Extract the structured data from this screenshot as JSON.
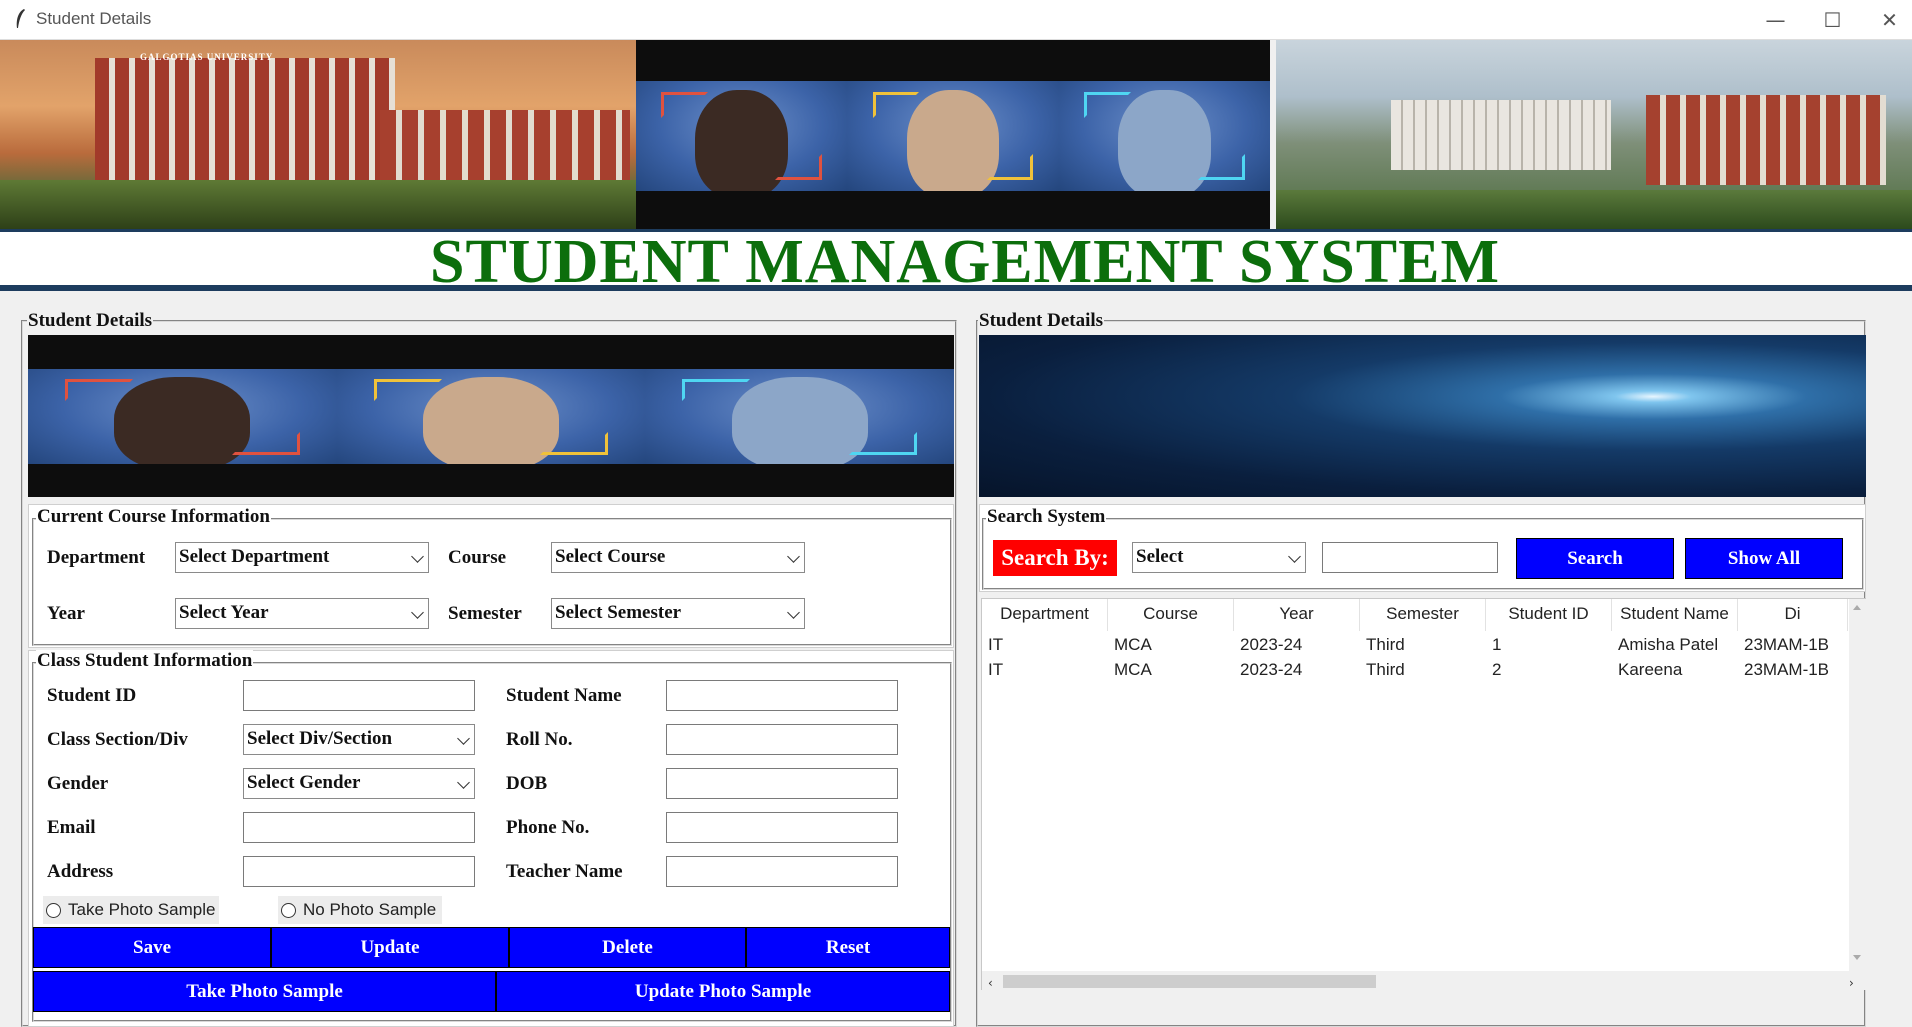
{
  "window": {
    "title": "Student Details",
    "minimize_glyph": "—",
    "maximize_glyph": "☐",
    "close_glyph": "✕"
  },
  "header": {
    "title": "STUDENT MANAGEMENT SYSTEM",
    "university_sign": "GALGOTIAS UNIVERSITY"
  },
  "left_panel": {
    "legend": "Student Details",
    "course_info": {
      "legend": "Current Course Information",
      "department_label": "Department",
      "department_value": "Select Department",
      "course_label": "Course",
      "course_value": "Select Course",
      "year_label": "Year",
      "year_value": "Select Year",
      "semester_label": "Semester",
      "semester_value": "Select Semester"
    },
    "class_info": {
      "legend": "Class Student Information",
      "student_id_label": "Student ID",
      "student_name_label": "Student Name",
      "section_label": "Class Section/Div",
      "section_value": "Select Div/Section",
      "roll_label": "Roll No.",
      "gender_label": "Gender",
      "gender_value": "Select Gender",
      "dob_label": "DOB",
      "email_label": "Email",
      "phone_label": "Phone No.",
      "address_label": "Address",
      "teacher_label": "Teacher Name",
      "radio_take": "Take Photo Sample",
      "radio_no": "No Photo Sample"
    },
    "buttons": {
      "save": "Save",
      "update": "Update",
      "delete": "Delete",
      "reset": "Reset",
      "take_photo": "Take Photo Sample",
      "update_photo": "Update Photo Sample"
    }
  },
  "right_panel": {
    "legend": "Student Details",
    "search": {
      "legend": "Search System",
      "search_by": "Search By:",
      "select_value": "Select",
      "search_button": "Search",
      "show_all_button": "Show All"
    },
    "table": {
      "columns": [
        "Department",
        "Course",
        "Year",
        "Semester",
        "Student ID",
        "Student Name",
        "Di"
      ],
      "rows": [
        [
          "IT",
          "MCA",
          "2023-24",
          "Third",
          "1",
          "Amisha Patel",
          "23MAM-1B"
        ],
        [
          "IT",
          "MCA",
          "2023-24",
          "Third",
          "2",
          "Kareena",
          "23MAM-1B"
        ]
      ]
    }
  },
  "colors": {
    "title_green": "#0c6e0c",
    "button_blue": "#0000ff",
    "search_red": "#ff0000"
  }
}
